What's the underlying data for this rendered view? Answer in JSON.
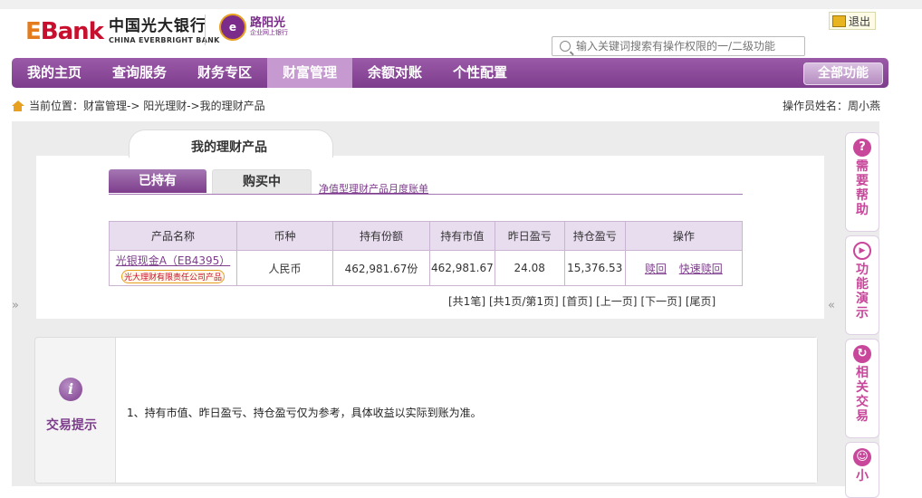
{
  "header": {
    "logo_bank": "Bank",
    "logo_bank_first": "E",
    "logo_cn": "中国光大银行",
    "logo_en": "CHINA EVERBRIGHT BANK",
    "sun_title": "路阳光",
    "sun_sub": "企业网上银行",
    "logout_label": "退出",
    "search_placeholder": "输入关键词搜索有操作权限的一/二级功能"
  },
  "nav": {
    "items": [
      {
        "label": "我的主页"
      },
      {
        "label": "查询服务"
      },
      {
        "label": "财务专区"
      },
      {
        "label": "财富管理"
      },
      {
        "label": "余额对账"
      },
      {
        "label": "个性配置"
      }
    ],
    "all_label": "全部功能"
  },
  "breadcrumb": {
    "text": "当前位置：财富管理-> 阳光理财->我的理财产品",
    "operator": "操作员姓名：周小燕"
  },
  "main": {
    "title": "我的理财产品",
    "tab_held": "已持有",
    "tab_buying": "购买中",
    "statement_link": "净值型理财产品月度账单",
    "table": {
      "headers": [
        "产品名称",
        "币种",
        "持有份额",
        "持有市值",
        "昨日盈亏",
        "持仓盈亏",
        "操作"
      ],
      "rows": [
        {
          "name": "光银现金A（EB4395）",
          "badge": "光大理财有限责任公司产品",
          "currency": "人民币",
          "shares": "462,981.67份",
          "market_value": "462,981.67",
          "yesterday_pl": "24.08",
          "position_pl": "15,376.53",
          "op_redeem": "赎回",
          "op_fast_redeem": "快速赎回"
        }
      ]
    },
    "pager": [
      "[共1笔]",
      "[共1页/第1页]",
      "[首页]",
      "[上一页]",
      "[下一页]",
      "[尾页]"
    ]
  },
  "tips": {
    "label": "交易提示",
    "text": "1、持有市值、昨日盈亏、持仓盈亏仅为参考，具体收益以实际到账为准。"
  },
  "sidebar_right": {
    "items": [
      {
        "label": "需要帮助",
        "icon": "question-icon"
      },
      {
        "label": "功能演示",
        "icon": "play-icon"
      },
      {
        "label": "相关交易",
        "icon": "refresh-icon"
      },
      {
        "label": "小",
        "icon": "smile-icon"
      }
    ]
  },
  "colors": {
    "brand": "#7d3d8c",
    "accent": "#e8a020",
    "red": "#c8102e"
  }
}
